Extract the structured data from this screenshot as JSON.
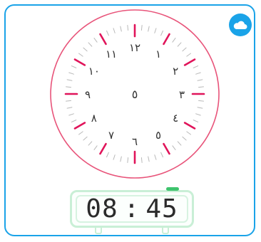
{
  "colors": {
    "frame": "#1aa3e8",
    "dial_ring": "#e8547a",
    "hour_mark": "#e0145a",
    "minute_tick": "#b9b9b9",
    "numeral": "#333333",
    "display_border": "#c9efd6",
    "display_indicator": "#3ec46d"
  },
  "corner_button": {
    "icon": "cloud-icon"
  },
  "clock": {
    "numerals": [
      "١٢",
      "١",
      "٢",
      "٣",
      "٤",
      "٥",
      "٦",
      "٧",
      "٨",
      "٩",
      "١٠",
      "١١"
    ],
    "center_mark": "٥"
  },
  "digital_display": {
    "hours": "08",
    "separator": ":",
    "minutes": "45"
  }
}
